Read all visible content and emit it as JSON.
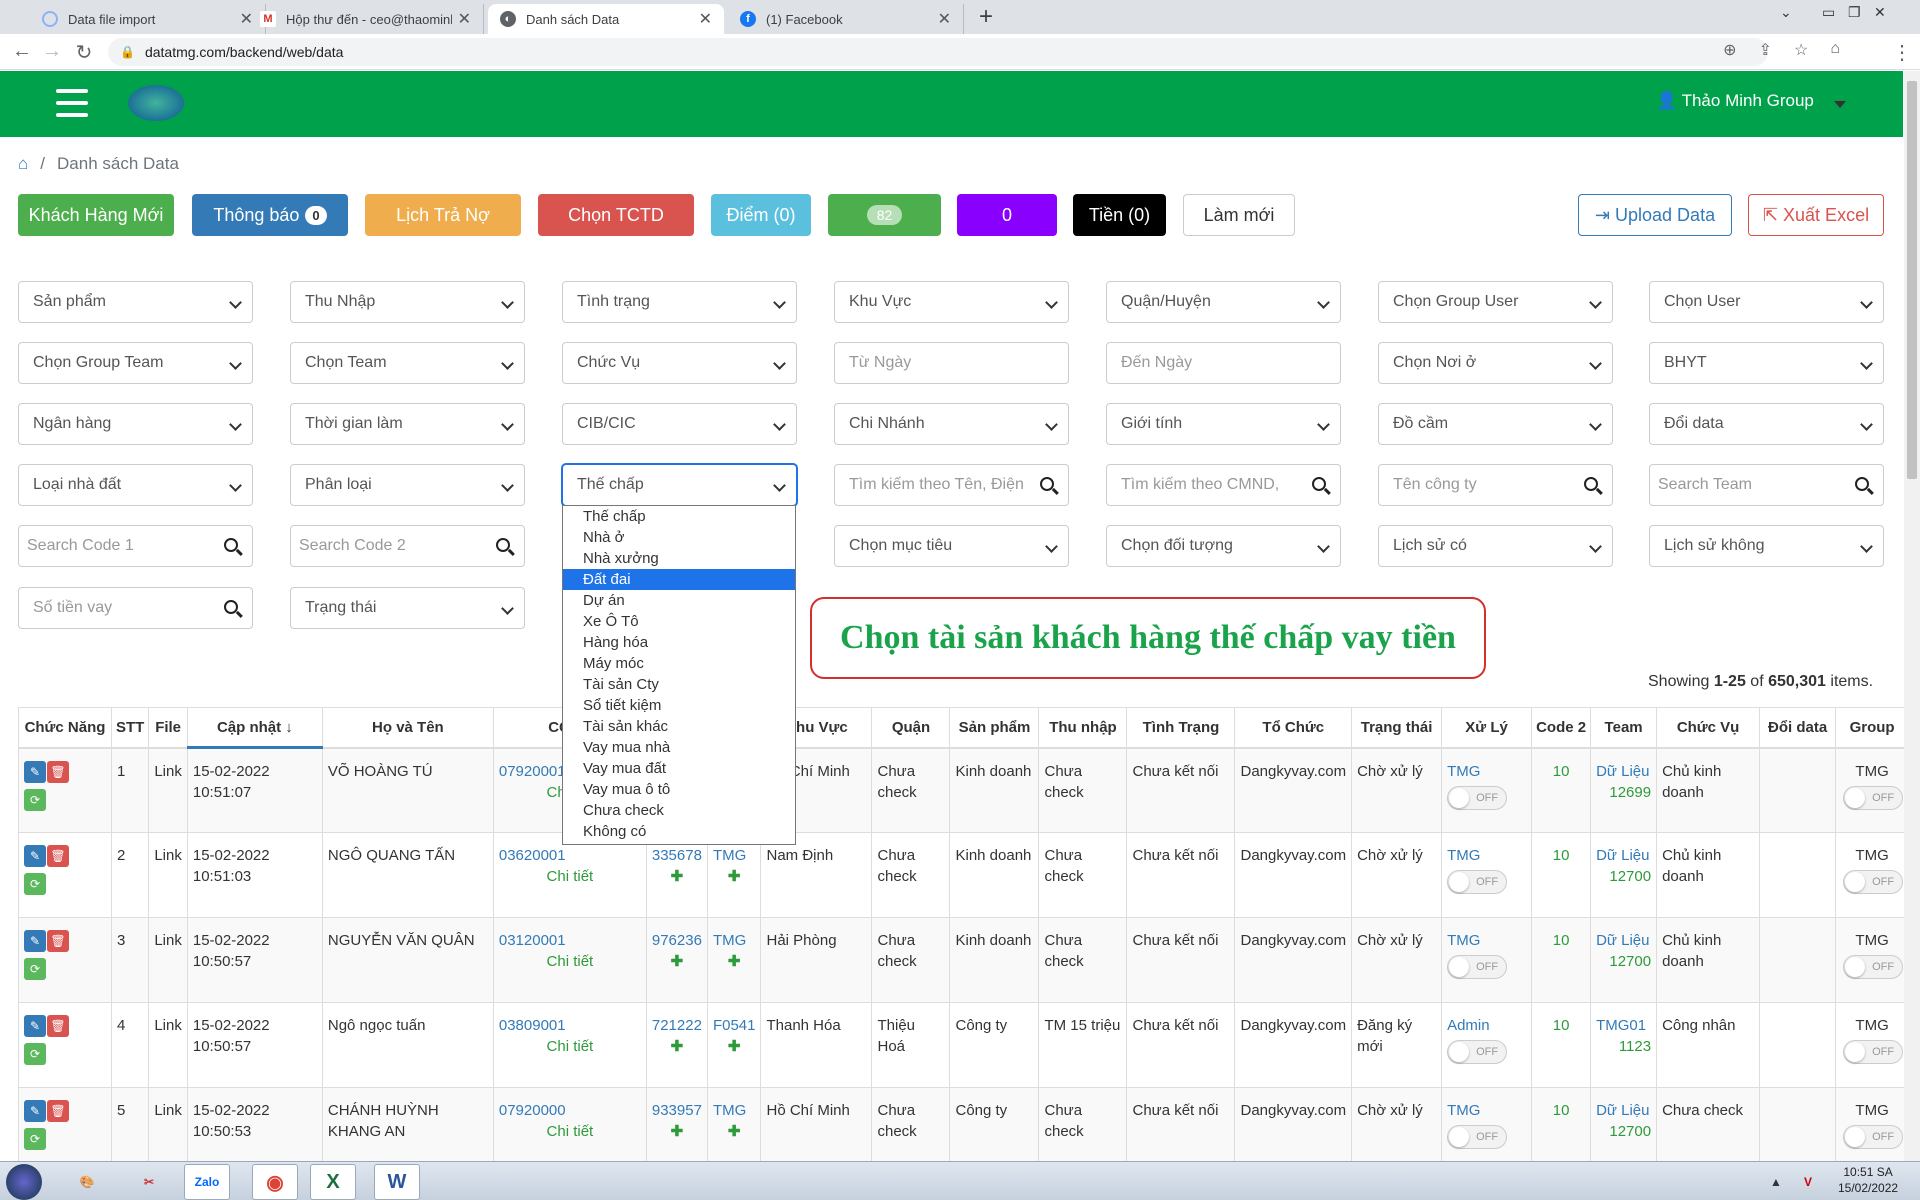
{
  "browser": {
    "tabs": [
      {
        "title": "Data file import"
      },
      {
        "title": "Hộp thư đến - ceo@thaominhgr"
      },
      {
        "title": "Danh sách Data"
      },
      {
        "title": "(1) Facebook"
      }
    ],
    "url": "datatmg.com/backend/web/data"
  },
  "header": {
    "user": "Thảo Minh Group"
  },
  "breadcrumb": {
    "current": "Danh sách Data"
  },
  "buttons": {
    "new_customer": "Khách Hàng Mới",
    "notify": "Thông báo",
    "notify_count": "0",
    "debt_schedule": "Lịch Trả Nợ",
    "choose_tctd": "Chọn TCTD",
    "points": "Điểm (0)",
    "green_count": "82",
    "purple_count": "0",
    "money": "Tiền (0)",
    "refresh": "Làm mới",
    "upload": "Upload Data",
    "export": "Xuất Excel"
  },
  "filters": {
    "r1": [
      "Sản phẩm",
      "Thu Nhập",
      "Tình trạng",
      "Khu Vực",
      "Quận/Huyện",
      "Chọn Group User",
      "Chọn User"
    ],
    "r2": [
      "Chọn Group Team",
      "Chọn Team",
      "Chức Vụ",
      "Từ Ngày",
      "Đến Ngày",
      "Chọn Nơi ở",
      "BHYT"
    ],
    "r3": [
      "Ngân hàng",
      "Thời gian làm",
      "CIB/CIC",
      "Chi Nhánh",
      "Giới tính",
      "Đồ cầm",
      "Đổi data"
    ],
    "r4": [
      "Loại nhà đất",
      "Phân loại",
      "Thế chấp",
      "Tìm kiếm theo Tên, Điện",
      "Tìm kiếm theo CMND,",
      "Tên công ty",
      "Search Team"
    ],
    "r5": [
      "Search Code 1",
      "Search Code 2",
      "Chọn mục tiêu",
      "Chọn đối tượng",
      "Lịch sử có",
      "Lịch sử không"
    ],
    "r6": [
      "Số tiền vay",
      "Trạng thái"
    ]
  },
  "dropdown_options": [
    "Thế chấp",
    "Nhà ở",
    "Nhà xưởng",
    "Đất đai",
    "Dự án",
    "Xe Ô Tô",
    "Hàng hóa",
    "Máy móc",
    "Tài sản Cty",
    "Sổ tiết kiệm",
    "Tài sản khác",
    "Vay mua nhà",
    "Vay mua đất",
    "Vay mua ô tô",
    "Chưa check",
    "Không có"
  ],
  "annotation": "Chọn tài sản khách hàng thế chấp vay tiền",
  "summary": {
    "prefix": "Showing ",
    "range": "1-25",
    "of": " of ",
    "total": "650,301",
    "suffix": " items."
  },
  "table": {
    "headers": [
      "Chức Năng",
      "STT",
      "File",
      "Cập nhật ↓",
      "Họ và Tên",
      "CCCD",
      "",
      "",
      "Khu Vực",
      "Quận",
      "Sản phẩm",
      "Thu nhập",
      "Tình Trạng",
      "Tổ Chức",
      "Trạng thái",
      "Xử Lý",
      "Code 2",
      "Team",
      "Chức Vụ",
      "Đổi data",
      "Group"
    ],
    "detail_label": "Chi tiết",
    "toggle_label": "OFF",
    "rows": [
      {
        "stt": "1",
        "file": "Link",
        "date": "15-02-2022",
        "time": "10:51:07",
        "name": "VÕ HOÀNG TÚ",
        "cccd": "07920001",
        "phone": "",
        "ref": "",
        "region": "Hồ Chí Minh",
        "district": "Chưa check",
        "product": "Kinh doanh",
        "income": "Chưa check",
        "status": "Chưa kết nối",
        "org": "Dangkyvay.com",
        "state": "Chờ xử lý",
        "handler": "TMG",
        "code2": "10",
        "team": "Dữ Liệu",
        "team_code": "12699",
        "position": "Chủ kinh doanh",
        "group": "TMG"
      },
      {
        "stt": "2",
        "file": "Link",
        "date": "15-02-2022",
        "time": "10:51:03",
        "name": "NGÔ QUANG TẤN",
        "cccd": "03620001",
        "phone": "335678",
        "ref": "TMG",
        "region": "Nam Định",
        "district": "Chưa check",
        "product": "Kinh doanh",
        "income": "Chưa check",
        "status": "Chưa kết nối",
        "org": "Dangkyvay.com",
        "state": "Chờ xử lý",
        "handler": "TMG",
        "code2": "10",
        "team": "Dữ Liệu",
        "team_code": "12700",
        "position": "Chủ kinh doanh",
        "group": "TMG"
      },
      {
        "stt": "3",
        "file": "Link",
        "date": "15-02-2022",
        "time": "10:50:57",
        "name": "NGUYỄN VĂN QUÂN",
        "cccd": "03120001",
        "phone": "976236",
        "ref": "TMG",
        "region": "Hải Phòng",
        "district": "Chưa check",
        "product": "Kinh doanh",
        "income": "Chưa check",
        "status": "Chưa kết nối",
        "org": "Dangkyvay.com",
        "state": "Chờ xử lý",
        "handler": "TMG",
        "code2": "10",
        "team": "Dữ Liệu",
        "team_code": "12700",
        "position": "Chủ kinh doanh",
        "group": "TMG"
      },
      {
        "stt": "4",
        "file": "Link",
        "date": "15-02-2022",
        "time": "10:50:57",
        "name": "Ngô ngọc tuấn",
        "cccd": "03809001",
        "phone": "721222",
        "ref": "F0541",
        "region": "Thanh Hóa",
        "district": "Thiệu Hoá",
        "product": "Công ty",
        "income": "TM 15 triệu",
        "status": "Chưa kết nối",
        "org": "Dangkyvay.com",
        "state": "Đăng ký mới",
        "handler": "Admin",
        "code2": "10",
        "team": "TMG01",
        "team_code": "1123",
        "position": "Công nhân",
        "group": "TMG"
      },
      {
        "stt": "5",
        "file": "Link",
        "date": "15-02-2022",
        "time": "10:50:53",
        "name": "CHÁNH HUỲNH KHANG AN",
        "cccd": "07920000",
        "phone": "933957",
        "ref": "TMG",
        "region": "Hồ Chí Minh",
        "district": "Chưa check",
        "product": "Công ty",
        "income": "Chưa check",
        "status": "Chưa kết nối",
        "org": "Dangkyvay.com",
        "state": "Chờ xử lý",
        "handler": "TMG",
        "code2": "10",
        "team": "Dữ Liệu",
        "team_code": "12700",
        "position": "Chưa check",
        "group": "TMG"
      }
    ]
  },
  "taskbar": {
    "time": "10:51 SA",
    "date": "15/02/2022"
  },
  "colors": {
    "brand_green": "#00a14b",
    "highlight": "#1e73e8",
    "annotation_border": "#d32f2f",
    "annotation_text": "#1aa34a"
  }
}
